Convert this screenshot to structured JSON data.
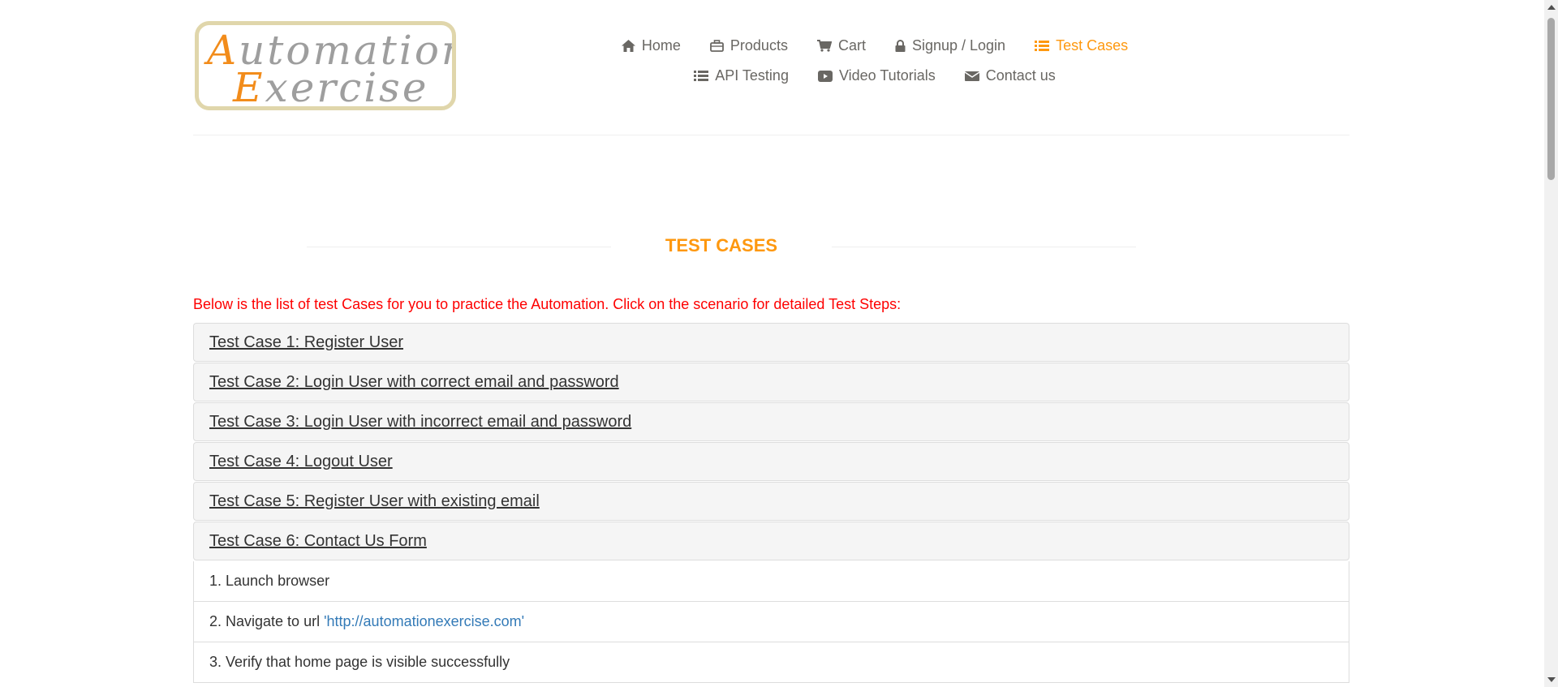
{
  "logo": {
    "line1_cap": "A",
    "line1_rest": "utomation",
    "line2_cap": "E",
    "line2_rest": "xercise"
  },
  "nav": {
    "home": "Home",
    "products": "Products",
    "cart": "Cart",
    "signup": "Signup / Login",
    "test_cases": "Test Cases",
    "api_testing": "API Testing",
    "video_tutorials": "Video Tutorials",
    "contact": "Contact us"
  },
  "page": {
    "title": "TEST CASES",
    "intro": "Below is the list of test Cases for you to practice the Automation. Click on the scenario for detailed Test Steps:"
  },
  "test_cases": [
    "Test Case 1: Register User",
    "Test Case 2: Login User with correct email and password",
    "Test Case 3: Login User with incorrect email and password",
    "Test Case 4: Logout User",
    "Test Case 5: Register User with existing email",
    "Test Case 6: Contact Us Form"
  ],
  "steps": {
    "step1": "1. Launch browser",
    "step2_prefix": "2. Navigate to url ",
    "step2_link": "'http://automationexercise.com'",
    "step3": "3. Verify that home page is visible successfully"
  },
  "colors": {
    "accent": "#fe980f",
    "intro": "#fe0000",
    "link": "#337ab7"
  }
}
